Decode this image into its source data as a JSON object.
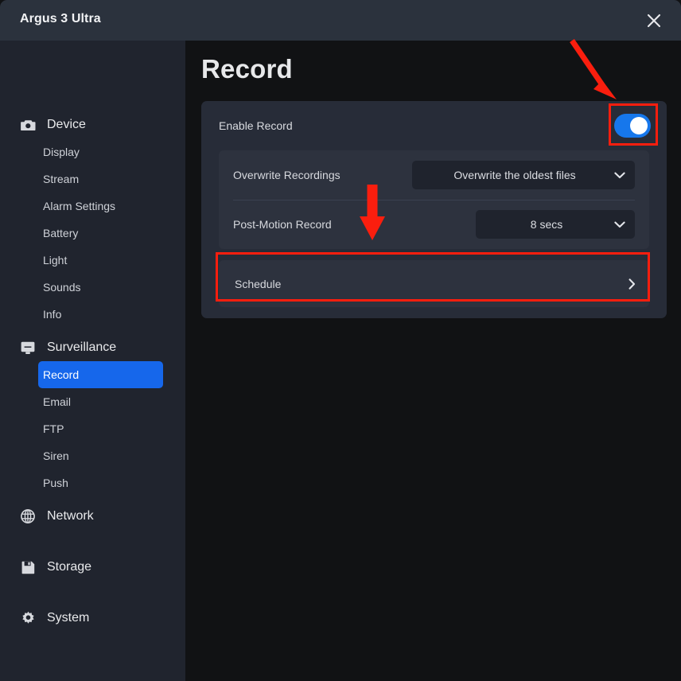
{
  "window": {
    "title": "Argus 3 Ultra",
    "close_icon": "close-icon"
  },
  "sidebar": {
    "groups": [
      {
        "label": "Device",
        "icon": "camera-icon",
        "items": [
          {
            "label": "Display",
            "active": false
          },
          {
            "label": "Stream",
            "active": false
          },
          {
            "label": "Alarm Settings",
            "active": false
          },
          {
            "label": "Battery",
            "active": false
          },
          {
            "label": "Light",
            "active": false
          },
          {
            "label": "Sounds",
            "active": false
          },
          {
            "label": "Info",
            "active": false
          }
        ]
      },
      {
        "label": "Surveillance",
        "icon": "monitor-icon",
        "items": [
          {
            "label": "Record",
            "active": true
          },
          {
            "label": "Email",
            "active": false
          },
          {
            "label": "FTP",
            "active": false
          },
          {
            "label": "Siren",
            "active": false
          },
          {
            "label": "Push",
            "active": false
          }
        ]
      },
      {
        "label": "Network",
        "icon": "globe-icon",
        "items": []
      },
      {
        "label": "Storage",
        "icon": "save-disk-icon",
        "items": []
      },
      {
        "label": "System",
        "icon": "gear-icon",
        "items": []
      }
    ]
  },
  "main": {
    "page_title": "Record",
    "enable_record": {
      "label": "Enable Record",
      "toggle_state": "on"
    },
    "settings": [
      {
        "label": "Overwrite Recordings",
        "value": "Overwrite the oldest files",
        "chevron": "chevron-down-icon"
      },
      {
        "label": "Post-Motion Record",
        "value": "8 secs",
        "chevron": "chevron-down-icon"
      }
    ],
    "schedule": {
      "label": "Schedule",
      "chevron": "chevron-right-icon"
    }
  },
  "annotations": {
    "color": "#fa1e0e",
    "arrow_to_toggle": "arrow-pointing-to-enable-toggle",
    "arrow_to_schedule": "arrow-pointing-to-schedule-row",
    "box_toggle": "highlight-box-enable-toggle",
    "box_schedule": "highlight-box-schedule-row"
  }
}
